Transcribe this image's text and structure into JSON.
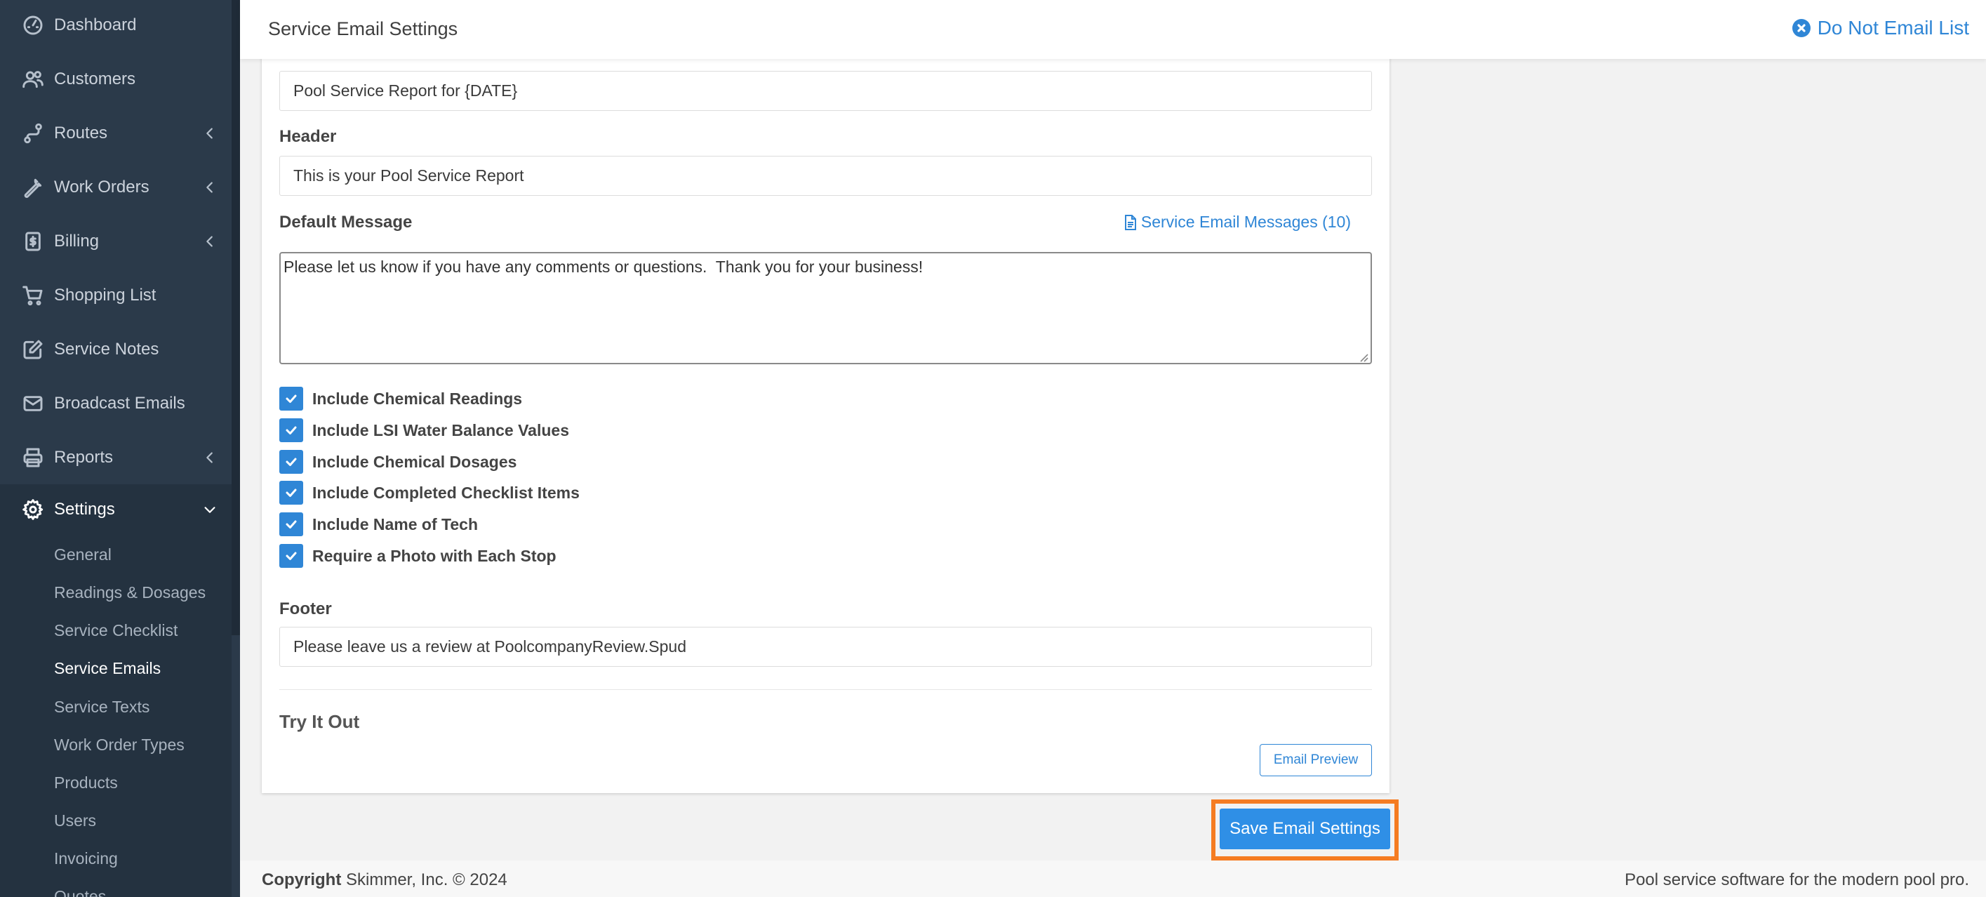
{
  "sidebar": {
    "items": [
      {
        "label": "Dashboard",
        "icon": "dashboard-icon"
      },
      {
        "label": "Customers",
        "icon": "customers-icon"
      },
      {
        "label": "Routes",
        "icon": "routes-icon"
      },
      {
        "label": "Work Orders",
        "icon": "wrench-icon"
      },
      {
        "label": "Billing",
        "icon": "billing-icon"
      },
      {
        "label": "Shopping List",
        "icon": "cart-icon"
      },
      {
        "label": "Service Notes",
        "icon": "notes-icon"
      },
      {
        "label": "Broadcast Emails",
        "icon": "envelope-icon"
      },
      {
        "label": "Reports",
        "icon": "printer-icon"
      },
      {
        "label": "Settings",
        "icon": "gear-icon"
      }
    ],
    "settings_submenu": [
      "General",
      "Readings & Dosages",
      "Service Checklist",
      "Service Emails",
      "Service Texts",
      "Work Order Types",
      "Products",
      "Users",
      "Invoicing",
      "Quotes"
    ],
    "active_item": "Settings",
    "current_subitem": "Service Emails"
  },
  "header": {
    "title": "Service Email Settings",
    "do_not_email_label": "Do Not Email List"
  },
  "form": {
    "subject_value": "Pool Service Report for {DATE}",
    "header_label": "Header",
    "header_value": "This is your Pool Service Report",
    "default_message_label": "Default Message",
    "messages_link": "Service Email Messages (10)",
    "default_message_value": "Please let us know if you have any comments or questions.  Thank you for your business!",
    "checkboxes": [
      {
        "label": "Include Chemical Readings",
        "checked": true
      },
      {
        "label": "Include LSI Water Balance Values",
        "checked": true
      },
      {
        "label": "Include Chemical Dosages",
        "checked": true
      },
      {
        "label": "Include Completed Checklist Items",
        "checked": true
      },
      {
        "label": "Include Name of Tech",
        "checked": true
      },
      {
        "label": "Require a Photo with Each Stop",
        "checked": true
      }
    ],
    "footer_label": "Footer",
    "footer_value": "Please leave us a review at PoolcompanyReview.Spud",
    "try_it_out": "Try It Out",
    "preview_button": "Email Preview"
  },
  "save_button": "Save Email Settings",
  "footer": {
    "copyright_bold": "Copyright",
    "copyright_rest": " Skimmer, Inc. © 2024",
    "tagline": "Pool service software for the modern pool pro."
  },
  "colors": {
    "sidebar_bg": "#2b3a4a",
    "accent": "#2f86d6",
    "highlight": "#f57c22"
  }
}
